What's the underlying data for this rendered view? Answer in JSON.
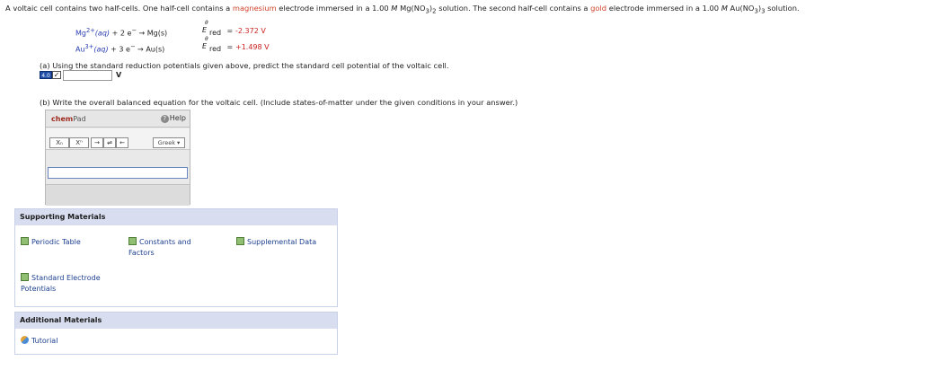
{
  "intro": {
    "p1": "A voltaic cell contains two half-cells. One half-cell contains a ",
    "metal1": "magnesium",
    "p2": " electrode immersed in a 1.00 ",
    "M": "M",
    "sol1": " Mg(NO",
    "sol1_sub": "3",
    "sol1_end": ")",
    "sol1_sub2": "2",
    "p3": " solution. The second half-cell contains a ",
    "metal2": "gold",
    "p4": " electrode immersed in a 1.00 ",
    "sol2": " Au(NO",
    "sol2_sub": "3",
    "sol2_end": ")",
    "sol2_sub2": "3",
    "p5": " solution."
  },
  "half_reactions": [
    {
      "ion": "Mg",
      "charge": "2+",
      "state": "(aq)",
      "electrons": " + 2 e",
      "arrow": " → ",
      "product": "Mg(s)",
      "e_symbol": "E",
      "e_sup": "θ",
      "e_sub": "red",
      "eq": " = ",
      "value": "-2.372 V"
    },
    {
      "ion": "Au",
      "charge": "3+",
      "state": "(aq)",
      "electrons": " + 3 e",
      "arrow": " → ",
      "product": "Au(s)",
      "e_symbol": "E",
      "e_sup": "θ",
      "e_sub": "red",
      "eq": " = ",
      "value": "+1.498 V"
    }
  ],
  "part_a": {
    "question": "(a) Using the standard reduction potentials given above, predict the standard cell potential of the voltaic cell.",
    "score": "4.0",
    "answer_value": "",
    "unit": "V"
  },
  "part_b": {
    "question": "(b) Write the overall balanced equation for the voltaic cell. (Include states-of-matter under the given conditions in your answer.)"
  },
  "chempad": {
    "brand": "chem",
    "brand_suffix": "Pad",
    "help": "Help",
    "buttons": [
      "Xₙ",
      "Xⁿ",
      "→",
      "⇌",
      "←"
    ],
    "greek": "Greek ▾",
    "input_value": ""
  },
  "supporting": {
    "title": "Supporting Materials",
    "links": [
      "Periodic Table",
      "Constants and Factors",
      "Supplemental Data",
      "Standard Electrode Potentials"
    ]
  },
  "additional": {
    "title": "Additional Materials",
    "links": [
      "Tutorial"
    ]
  },
  "colors": {
    "accent": "#d0422a",
    "link": "#1d3f8f",
    "panel_header": "#d8def0"
  }
}
